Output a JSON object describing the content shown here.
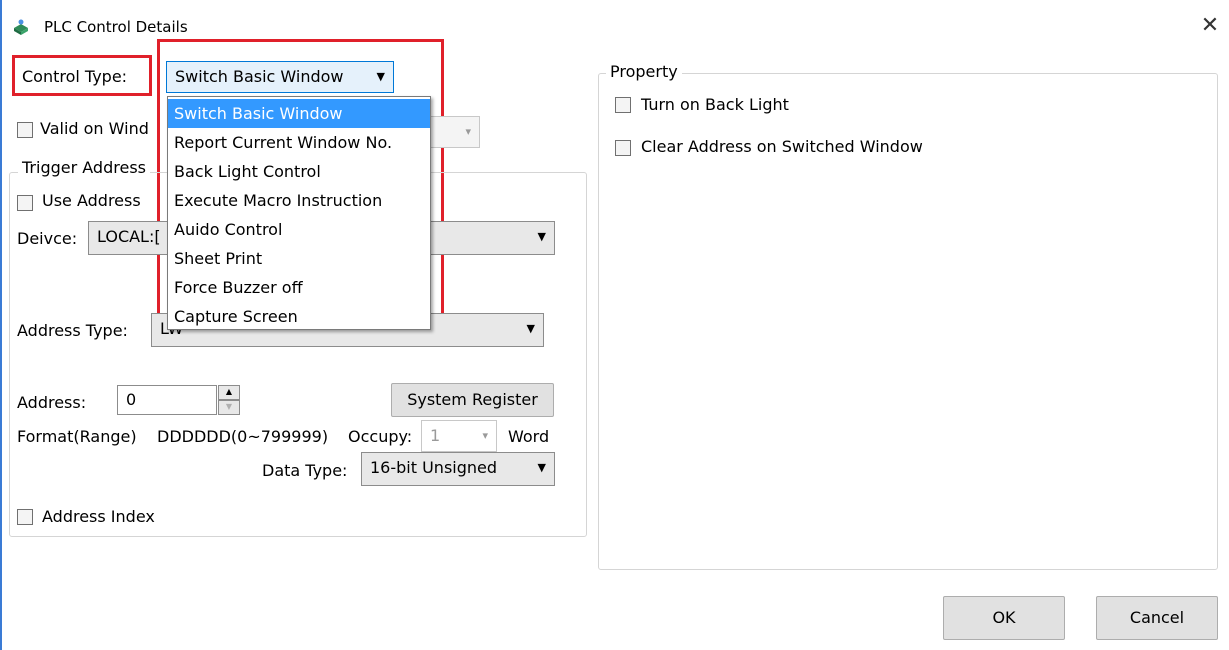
{
  "window": {
    "title": "PLC Control Details",
    "close_symbol": "✕",
    "icons": {
      "app": "plc-app-icon",
      "close": "close-icon"
    }
  },
  "control_type": {
    "label": "Control Type:",
    "selected": "Switch Basic Window",
    "options": [
      "Switch Basic Window",
      "Report Current Window No.",
      "Back Light Control",
      "Execute Macro Instruction",
      "Auido Control",
      "Sheet Print",
      "Force Buzzer off",
      "Capture Screen"
    ]
  },
  "valid_on_window": {
    "label": "Valid on Wind",
    "checked": false
  },
  "trigger_group": {
    "legend": "Trigger Address",
    "use_address": {
      "label": "Use Address",
      "checked": false
    },
    "device": {
      "label": "Deivce:",
      "value": "LOCAL:["
    },
    "address_type": {
      "label": "Address Type:",
      "value": "LW"
    },
    "address": {
      "label": "Address:",
      "value": "0"
    },
    "system_register_button": "System Register",
    "format": {
      "label": "Format(Range)",
      "range": "DDDDDD(0~799999)",
      "occupy_label": "Occupy:",
      "occupy_value": "1",
      "unit": "Word"
    },
    "data_type": {
      "label": "Data Type:",
      "value": "16-bit Unsigned"
    },
    "address_index": {
      "label": "Address Index",
      "checked": false
    }
  },
  "property_group": {
    "legend": "Property",
    "turn_on_back_light": {
      "label": "Turn on Back Light",
      "checked": false
    },
    "clear_address": {
      "label": "Clear Address on Switched Window",
      "checked": false
    }
  },
  "buttons": {
    "ok": "OK",
    "cancel": "Cancel"
  },
  "colors": {
    "highlight_red": "#e0202a",
    "selection_blue": "#3399ff",
    "window_border_blue": "#3a7bd5"
  }
}
